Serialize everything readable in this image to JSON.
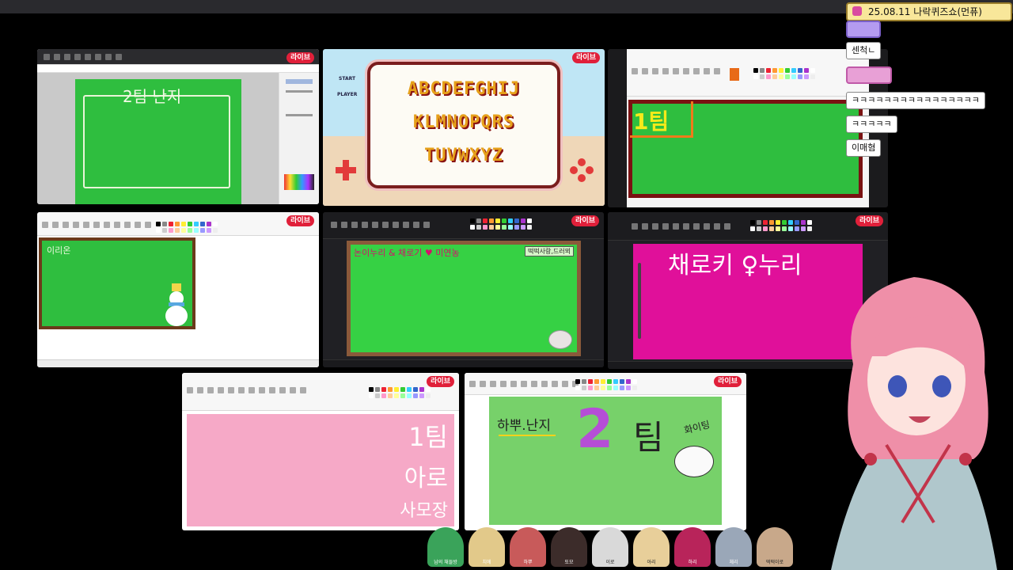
{
  "header": {
    "title": "25.08.11 나락퀴즈쇼(먼퓨)"
  },
  "live_label": "라이브",
  "tiles": {
    "t1": {
      "board_text": "2팀 난지"
    },
    "t2": {
      "rows": [
        "ABCDEFGHIJ",
        "KLMNOPQRS",
        "TUVWXYZ"
      ],
      "start_label": "START",
      "player_label": "PLAYER"
    },
    "t3": {
      "board_text": "1팀"
    },
    "t4": {
      "board_text": "이리온"
    },
    "t5": {
      "board_text": "논이누리 & 채로기 ♥ 미연농",
      "tag": "떡떡사랑,드러뫼"
    },
    "t6": {
      "board_text": "채로키 ♀누리"
    },
    "t7": {
      "lines": [
        "1팀",
        "아로",
        "사모장"
      ]
    },
    "t8": {
      "left_text": "하뿌.난지",
      "big": "2",
      "right": "팀",
      "side": "화이팅"
    }
  },
  "chat": {
    "messages": [
      {
        "text": "센척ㄴ"
      },
      {
        "text": "ㅋㅋㅋㅋㅋㅋㅋㅋㅋㅋㅋㅋㅋㅋㅋㅋ"
      },
      {
        "text": "ㅋㅋㅋㅋㅋ"
      },
      {
        "text": "이매혐"
      }
    ]
  },
  "participants": [
    {
      "name": "남의 채들방"
    },
    {
      "name": "치에"
    },
    {
      "name": "하뿌"
    },
    {
      "name": "또모"
    },
    {
      "name": "이로"
    },
    {
      "name": "아리"
    },
    {
      "name": "하리"
    },
    {
      "name": "체리"
    },
    {
      "name": "떡떡이로"
    }
  ],
  "colors": {
    "board_green": "#2fbe3f",
    "board_pink": "#f6a9c7",
    "board_magenta": "#e0109a",
    "live_red": "#e0203a",
    "title_bg": "#f8e79a"
  }
}
